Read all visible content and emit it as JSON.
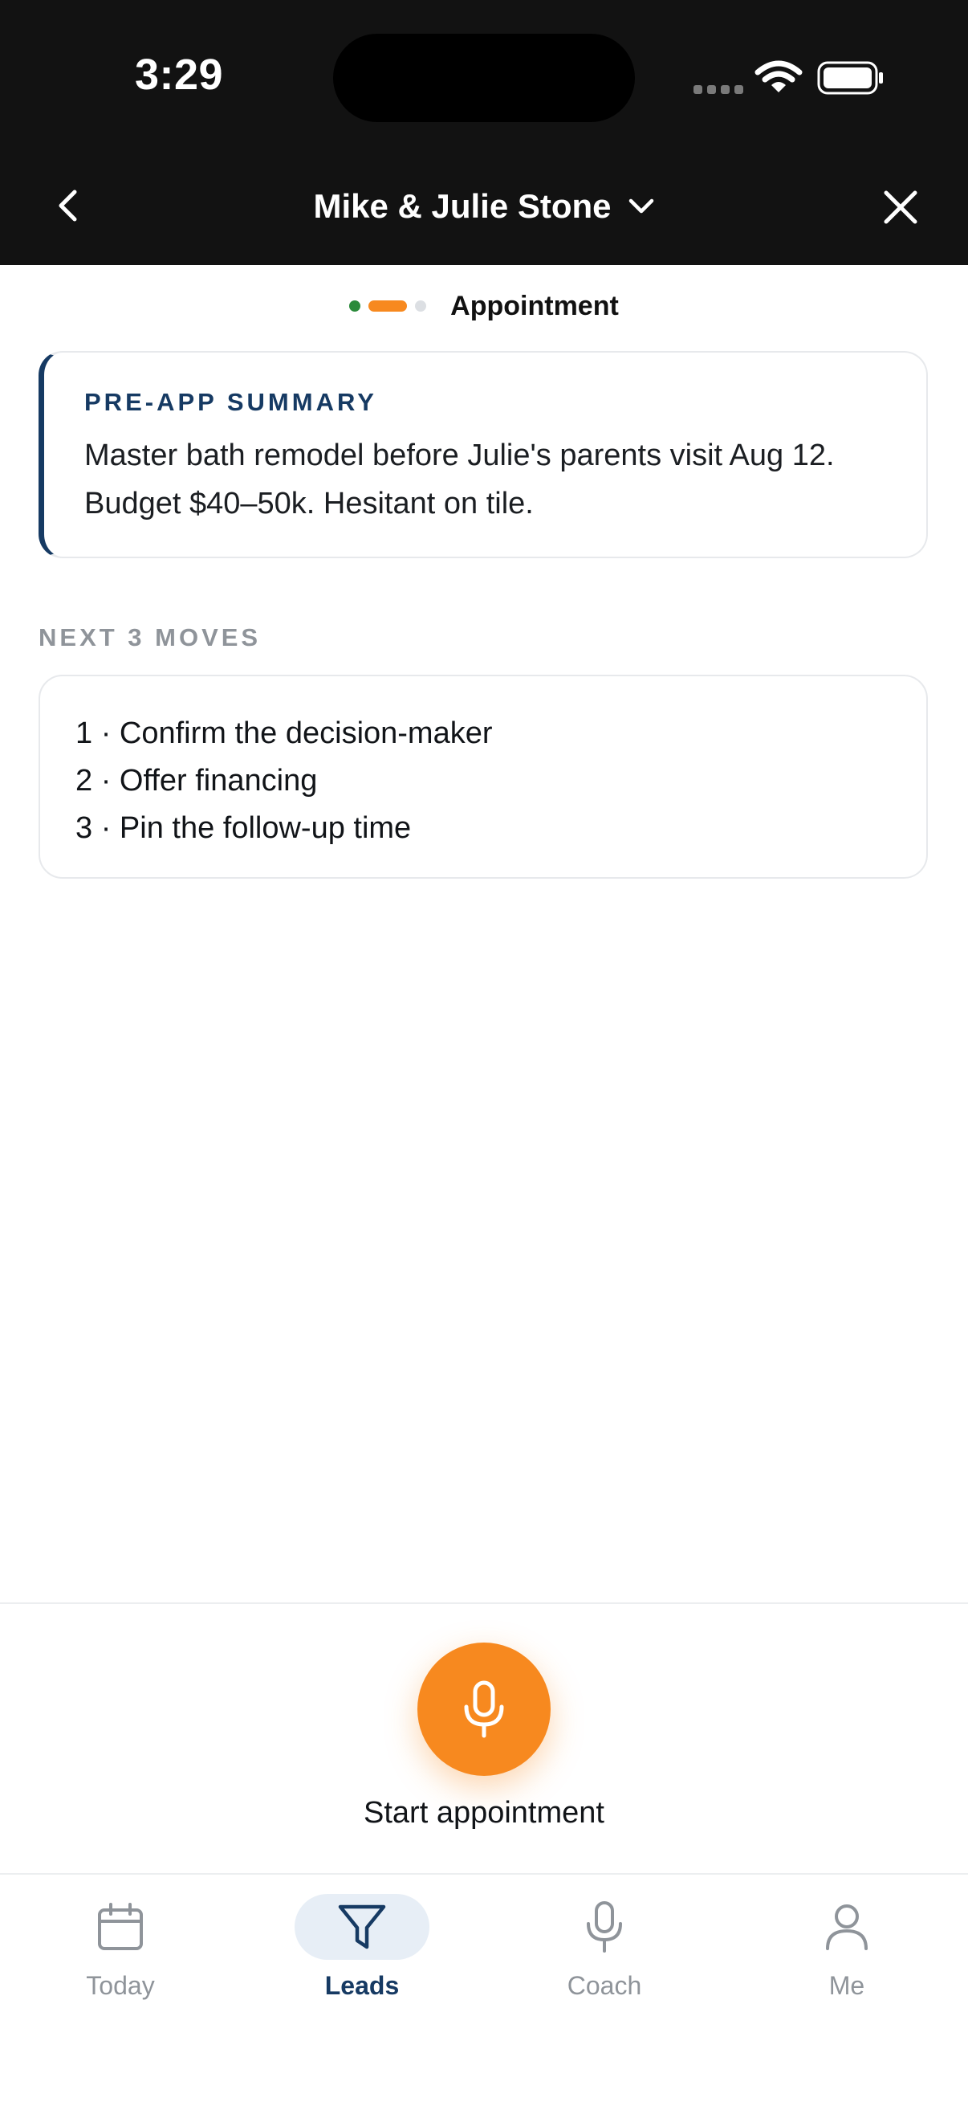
{
  "status_bar": {
    "time": "3:29"
  },
  "nav": {
    "title": "Mike & Julie Stone",
    "back_icon": "chevron-left-icon",
    "dropdown_icon": "chevron-down-icon",
    "close_icon": "close-icon"
  },
  "progress": {
    "step_label": "Appointment",
    "colors": {
      "done": "#2a8a3a",
      "current": "#f7891f",
      "pending": "#dcdfe3"
    }
  },
  "summary": {
    "title": "PRE-APP SUMMARY",
    "text": "Master bath remodel before Julie's parents visit Aug 12. Budget $40–50k. Hesitant on tile."
  },
  "next_moves": {
    "heading": "NEXT 3 MOVES",
    "items": [
      "1 · Confirm the decision-maker",
      "2 · Offer financing",
      "3 · Pin the follow-up time"
    ]
  },
  "start": {
    "label": "Start appointment",
    "icon": "microphone-icon",
    "accent": "#f7891f"
  },
  "tabs": [
    {
      "label": "Today",
      "icon": "calendar-icon",
      "active": false
    },
    {
      "label": "Leads",
      "icon": "filter-icon",
      "active": true
    },
    {
      "label": "Coach",
      "icon": "microphone-icon",
      "active": false
    },
    {
      "label": "Me",
      "icon": "person-icon",
      "active": false
    }
  ],
  "colors": {
    "header_bg": "#121212",
    "brand_navy": "#163a63"
  }
}
